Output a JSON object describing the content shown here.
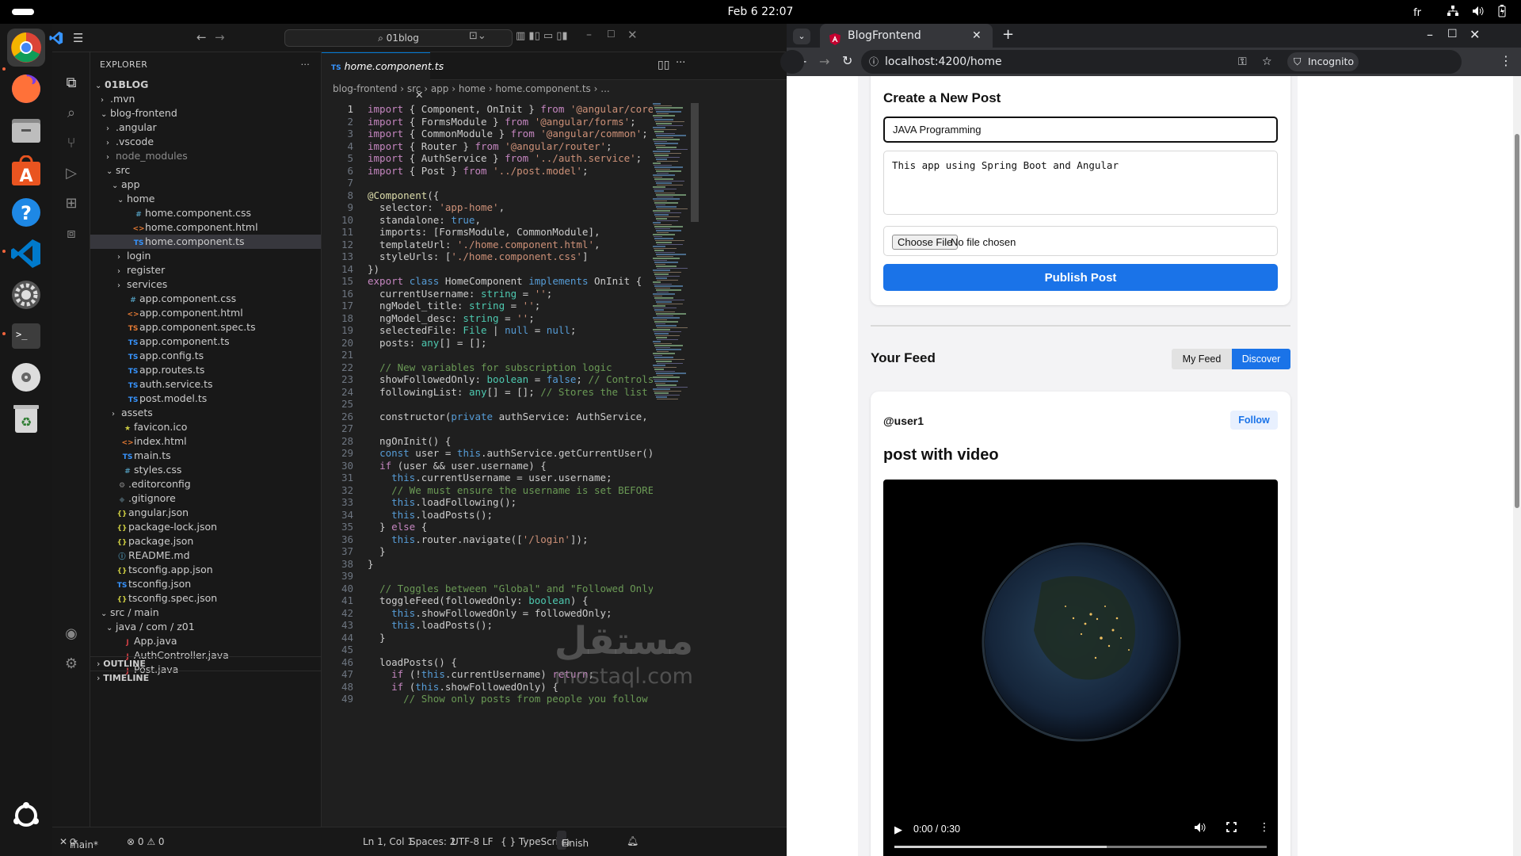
{
  "topbar": {
    "clock": "Feb 6  22:07",
    "keyboard": "fr"
  },
  "vscode": {
    "search": "01blog",
    "explorer_title": "EXPLORER",
    "tab_label": "home.component.ts",
    "breadcrumb": [
      "blog-frontend",
      "src",
      "app",
      "home",
      "home.component.ts",
      "..."
    ],
    "tree": [
      {
        "label": "01BLOG",
        "indent": 0,
        "chev": "v",
        "icon": "",
        "bold": true
      },
      {
        "label": ".mvn",
        "indent": 1,
        "chev": ">",
        "icon": ""
      },
      {
        "label": "blog-frontend",
        "indent": 1,
        "chev": "v",
        "icon": ""
      },
      {
        "label": ".angular",
        "indent": 2,
        "chev": ">",
        "icon": ""
      },
      {
        "label": ".vscode",
        "indent": 2,
        "chev": ">",
        "icon": ""
      },
      {
        "label": "node_modules",
        "indent": 2,
        "chev": ">",
        "icon": "",
        "dim": true
      },
      {
        "label": "src",
        "indent": 2,
        "chev": "v",
        "icon": ""
      },
      {
        "label": "app",
        "indent": 3,
        "chev": "v",
        "icon": ""
      },
      {
        "label": "home",
        "indent": 4,
        "chev": "v",
        "icon": ""
      },
      {
        "label": "home.component.css",
        "indent": 5,
        "chev": "",
        "icon": "#"
      },
      {
        "label": "home.component.html",
        "indent": 5,
        "chev": "",
        "icon": "<>"
      },
      {
        "label": "home.component.ts",
        "indent": 5,
        "chev": "",
        "icon": "TS",
        "selected": true
      },
      {
        "label": "login",
        "indent": 4,
        "chev": ">",
        "icon": ""
      },
      {
        "label": "register",
        "indent": 4,
        "chev": ">",
        "icon": ""
      },
      {
        "label": "services",
        "indent": 4,
        "chev": ">",
        "icon": ""
      },
      {
        "label": "app.component.css",
        "indent": 4,
        "chev": "",
        "icon": "#"
      },
      {
        "label": "app.component.html",
        "indent": 4,
        "chev": "",
        "icon": "<>"
      },
      {
        "label": "app.component.spec.ts",
        "indent": 4,
        "chev": "",
        "icon": "TS",
        "spec": true
      },
      {
        "label": "app.component.ts",
        "indent": 4,
        "chev": "",
        "icon": "TS"
      },
      {
        "label": "app.config.ts",
        "indent": 4,
        "chev": "",
        "icon": "TS"
      },
      {
        "label": "app.routes.ts",
        "indent": 4,
        "chev": "",
        "icon": "TS"
      },
      {
        "label": "auth.service.ts",
        "indent": 4,
        "chev": "",
        "icon": "TS"
      },
      {
        "label": "post.model.ts",
        "indent": 4,
        "chev": "",
        "icon": "TS"
      },
      {
        "label": "assets",
        "indent": 3,
        "chev": ">",
        "icon": ""
      },
      {
        "label": "favicon.ico",
        "indent": 3,
        "chev": "",
        "icon": "★"
      },
      {
        "label": "index.html",
        "indent": 3,
        "chev": "",
        "icon": "<>"
      },
      {
        "label": "main.ts",
        "indent": 3,
        "chev": "",
        "icon": "TS"
      },
      {
        "label": "styles.css",
        "indent": 3,
        "chev": "",
        "icon": "#"
      },
      {
        "label": ".editorconfig",
        "indent": 2,
        "chev": "",
        "icon": "⚙"
      },
      {
        "label": ".gitignore",
        "indent": 2,
        "chev": "",
        "icon": "◆"
      },
      {
        "label": "angular.json",
        "indent": 2,
        "chev": "",
        "icon": "{}"
      },
      {
        "label": "package-lock.json",
        "indent": 2,
        "chev": "",
        "icon": "{}"
      },
      {
        "label": "package.json",
        "indent": 2,
        "chev": "",
        "icon": "{}"
      },
      {
        "label": "README.md",
        "indent": 2,
        "chev": "",
        "icon": "ⓘ"
      },
      {
        "label": "tsconfig.app.json",
        "indent": 2,
        "chev": "",
        "icon": "{}"
      },
      {
        "label": "tsconfig.json",
        "indent": 2,
        "chev": "",
        "icon": "TS"
      },
      {
        "label": "tsconfig.spec.json",
        "indent": 2,
        "chev": "",
        "icon": "{}"
      },
      {
        "label": "src / main",
        "indent": 1,
        "chev": "v",
        "icon": ""
      },
      {
        "label": "java / com / z01",
        "indent": 2,
        "chev": "v",
        "icon": ""
      },
      {
        "label": "App.java",
        "indent": 3,
        "chev": "",
        "icon": "J"
      },
      {
        "label": "AuthController.java",
        "indent": 3,
        "chev": "",
        "icon": "J"
      },
      {
        "label": "Post.java",
        "indent": 3,
        "chev": "",
        "icon": "J"
      }
    ],
    "sections": {
      "outline": "OUTLINE",
      "timeline": "TIMELINE"
    },
    "code": [
      "import { Component, OnInit } from '@angular/core';",
      "import { FormsModule } from '@angular/forms';",
      "import { CommonModule } from '@angular/common';",
      "import { Router } from '@angular/router';",
      "import { AuthService } from '../auth.service';",
      "import { Post } from '../post.model';",
      "",
      "@Component({",
      "  selector: 'app-home',",
      "  standalone: true,",
      "  imports: [FormsModule, CommonModule],",
      "  templateUrl: './home.component.html',",
      "  styleUrls: ['./home.component.css']",
      "})",
      "export class HomeComponent implements OnInit {",
      "  currentUsername: string = '';",
      "  ngModel_title: string = '';",
      "  ngModel_desc: string = '';",
      "  selectedFile: File | null = null;",
      "  posts: any[] = [];",
      "",
      "  // New variables for subscription logic",
      "  showFollowedOnly: boolean = false; // Controls whi",
      "  followingList: any[] = []; // Stores the list of u",
      "",
      "  constructor(private authService: AuthService, priv",
      "",
      "  ngOnInit() {",
      "  const user = this.authService.getCurrentUser();",
      "  if (user && user.username) {",
      "    this.currentUsername = user.username;",
      "    // We must ensure the username is set BEFORE we",
      "    this.loadFollowing();",
      "    this.loadPosts();",
      "  } else {",
      "    this.router.navigate(['/login']);",
      "  }",
      "}",
      "",
      "  // Toggles between \"Global\" and \"Followed Only\"",
      "  toggleFeed(followedOnly: boolean) {",
      "    this.showFollowedOnly = followedOnly;",
      "    this.loadPosts();",
      "  }",
      "",
      "  loadPosts() {",
      "    if (!this.currentUsername) return;",
      "    if (this.showFollowedOnly) {",
      "      // Show only posts from people you follow"
    ],
    "status": {
      "branch": "main*",
      "problems": "⊗ 0 ⚠ 0",
      "position": "Ln 1, Col 1",
      "spaces": "Spaces: 2",
      "encoding": "UTF-8",
      "eol": "LF",
      "language": "{ } TypeScript",
      "finish": "Finish Setup"
    }
  },
  "chrome": {
    "tab_title": "BlogFrontend",
    "url": "localhost:4200/home",
    "incognito": "Incognito"
  },
  "page": {
    "create_title": "Create a New Post",
    "title_value": "JAVA Programming",
    "desc_value": "This app using Spring Boot and Angular",
    "choose_file": "Choose File",
    "no_file": "No file chosen",
    "publish": "Publish Post",
    "feed_title": "Your Feed",
    "my_feed": "My Feed",
    "discover": "Discover",
    "post_user": "@user1",
    "follow": "Follow",
    "post_title": "post with video",
    "video_time": "0:00 / 0:30",
    "video_progress": 0.57
  },
  "watermark": {
    "arabic": "مستقل",
    "latin": "mostaql.com"
  },
  "colors": {
    "accent": "#1a73e8",
    "vscode_bg": "#1f1f1f",
    "discover_bg": "#1a73e8"
  }
}
